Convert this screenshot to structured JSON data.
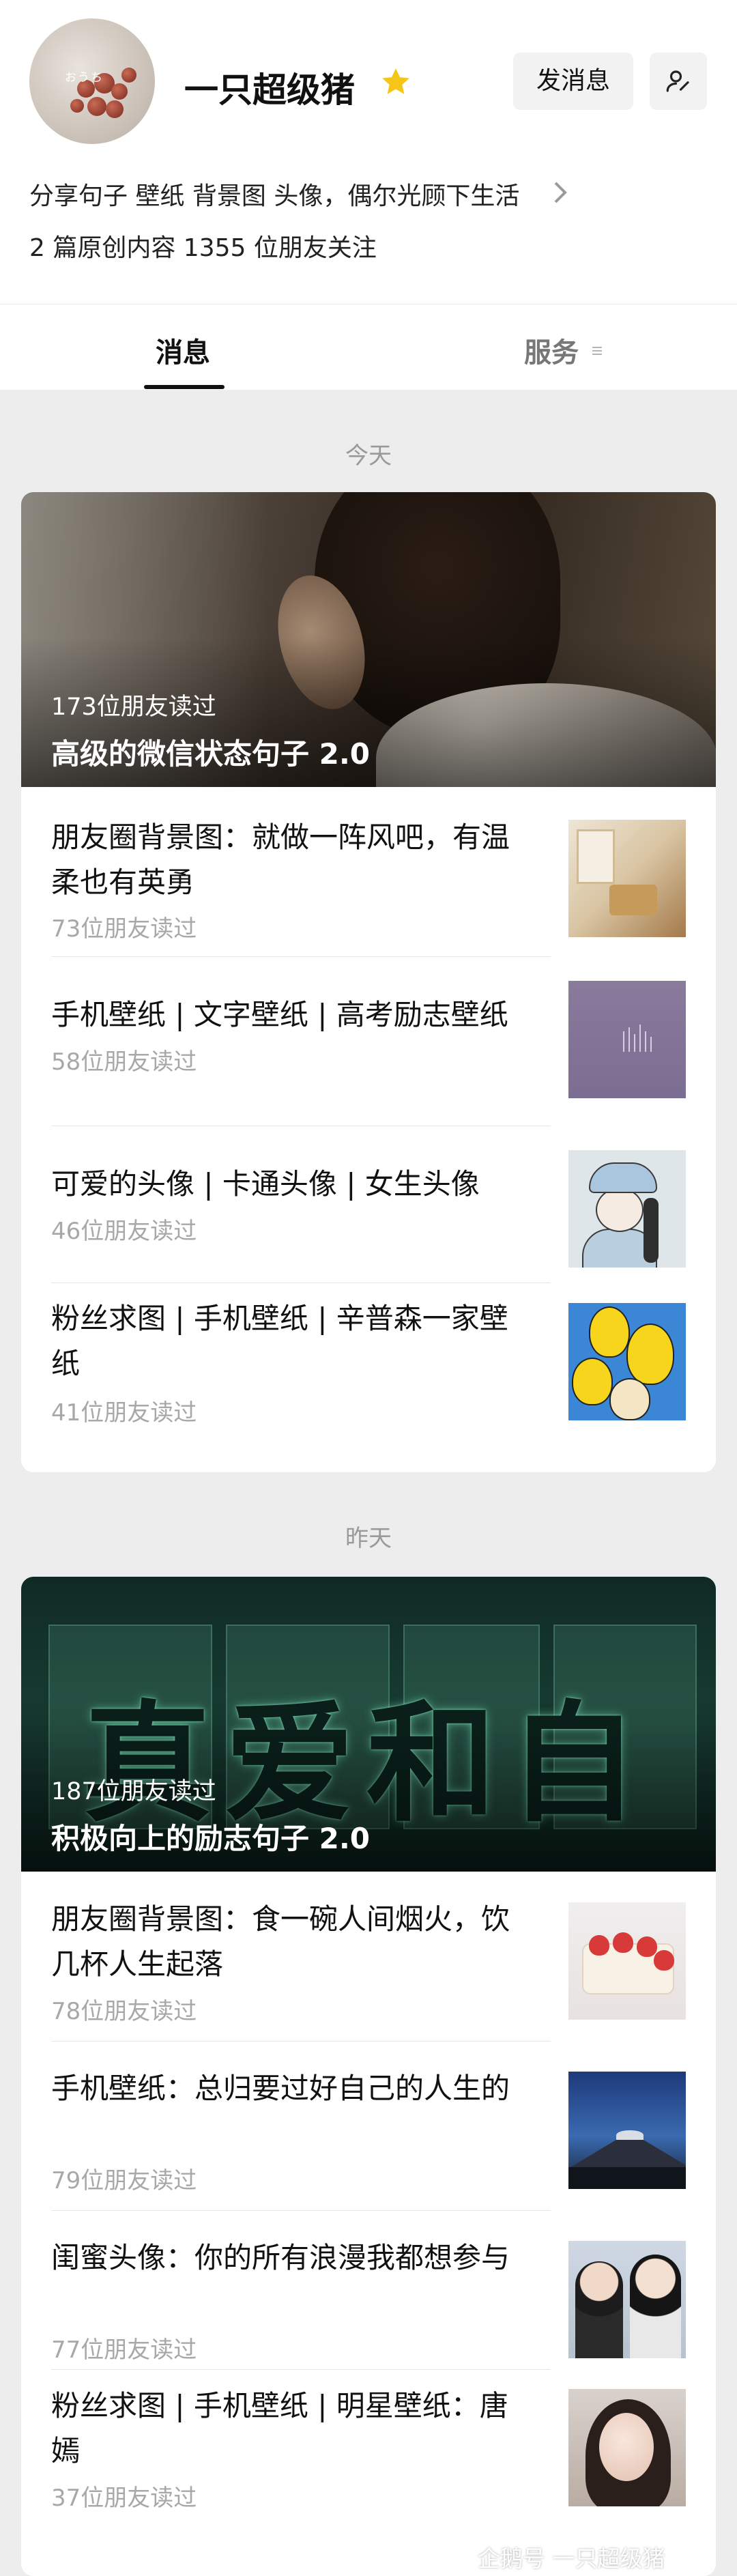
{
  "profile": {
    "name": "一只超级猪",
    "bio": "分享句子 壁纸 背景图 头像，偶尔光顾下生活",
    "stats": "2 篇原创内容  1355 位朋友关注",
    "avatar_text": "おうち",
    "send_message_label": "发消息"
  },
  "tabs": {
    "messages": "消息",
    "services": "服务"
  },
  "groups": [
    {
      "day": "今天",
      "cover": {
        "read": "173位朋友读过",
        "title": "高级的微信状态句子 2.0"
      },
      "items": [
        {
          "title": "朋友圈背景图：就做一阵风吧，有温柔也有英勇",
          "read": "73位朋友读过"
        },
        {
          "title": "手机壁纸 | 文字壁纸 | 高考励志壁纸",
          "read": "58位朋友读过"
        },
        {
          "title": "可爱的头像 | 卡通头像 | 女生头像",
          "read": "46位朋友读过"
        },
        {
          "title": "粉丝求图 | 手机壁纸 | 辛普森一家壁纸",
          "read": "41位朋友读过"
        }
      ]
    },
    {
      "day": "昨天",
      "cover": {
        "read": "187位朋友读过",
        "title": "积极向上的励志句子 2.0",
        "art_text": "真爱和自由"
      },
      "items": [
        {
          "title": "朋友圈背景图：食一碗人间烟火，饮几杯人生起落",
          "read": "78位朋友读过"
        },
        {
          "title": "手机壁纸：总归要过好自己的人生的",
          "read": "79位朋友读过"
        },
        {
          "title": "闺蜜头像：你的所有浪漫我都想参与",
          "read": "77位朋友读过"
        },
        {
          "title": "粉丝求图 | 手机壁纸 | 明星壁纸：唐嫣",
          "read": "37位朋友读过"
        }
      ]
    }
  ],
  "watermark": "企鹅号 一只超级猪",
  "colors": {
    "background": "#ededed",
    "card": "#ffffff",
    "star": "#f5c518",
    "read_count": "#a8a8a8"
  }
}
